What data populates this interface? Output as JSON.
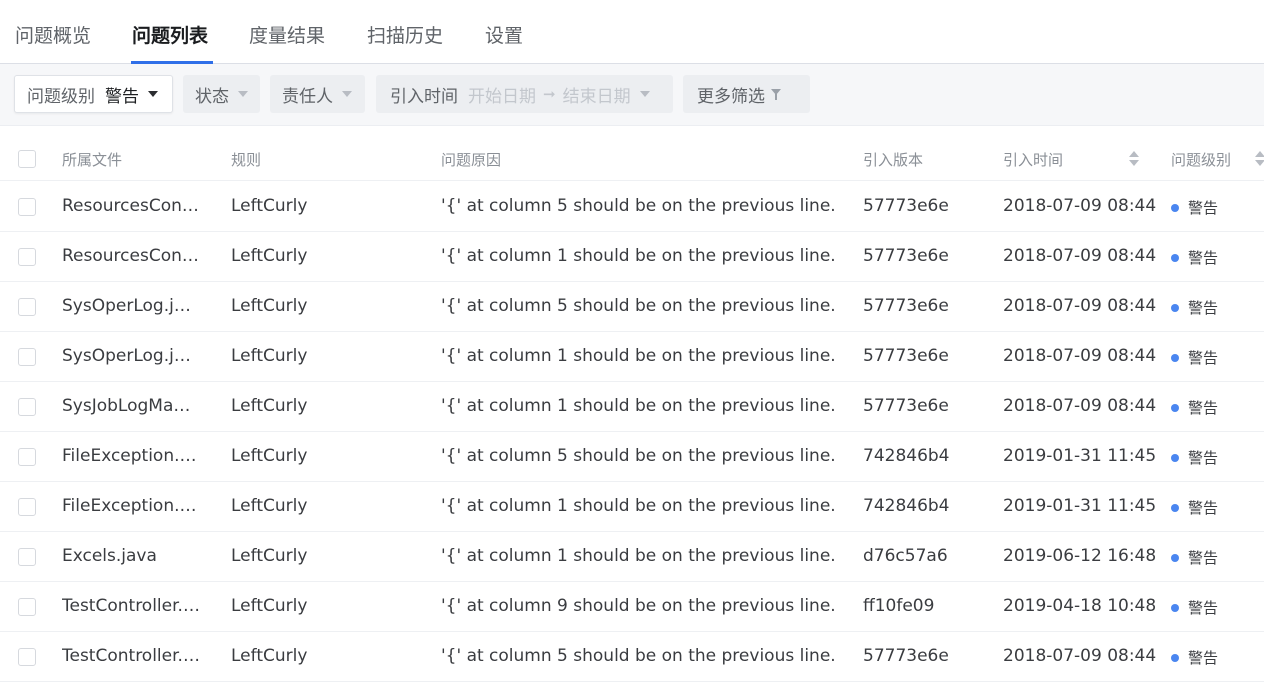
{
  "tabs": [
    {
      "label": "问题概览",
      "active": false
    },
    {
      "label": "问题列表",
      "active": true
    },
    {
      "label": "度量结果",
      "active": false
    },
    {
      "label": "扫描历史",
      "active": false
    },
    {
      "label": "设置",
      "active": false
    }
  ],
  "filters": {
    "level_label": "问题级别",
    "level_value": "警告",
    "status_label": "状态",
    "owner_label": "责任人",
    "intro_time_label": "引入时间",
    "start_date_placeholder": "开始日期",
    "date_separator": "➞",
    "end_date_placeholder": "结束日期",
    "more_filters_label": "更多筛选"
  },
  "table": {
    "columns": {
      "file": "所属文件",
      "rule": "规则",
      "reason": "问题原因",
      "version": "引入版本",
      "time": "引入时间",
      "level": "问题级别"
    },
    "level_dot_color": "#4a86f0",
    "rows": [
      {
        "file": "ResourcesConfig.java",
        "rule": "LeftCurly",
        "reason": "'{' at column 5 should be on the previous line.",
        "version": "57773e6e",
        "time": "2018-07-09 08:44",
        "level": "警告"
      },
      {
        "file": "ResourcesConfig.java",
        "rule": "LeftCurly",
        "reason": "'{' at column 1 should be on the previous line.",
        "version": "57773e6e",
        "time": "2018-07-09 08:44",
        "level": "警告"
      },
      {
        "file": "SysOperLog.java",
        "rule": "LeftCurly",
        "reason": "'{' at column 5 should be on the previous line.",
        "version": "57773e6e",
        "time": "2018-07-09 08:44",
        "level": "警告"
      },
      {
        "file": "SysOperLog.java",
        "rule": "LeftCurly",
        "reason": "'{' at column 1 should be on the previous line.",
        "version": "57773e6e",
        "time": "2018-07-09 08:44",
        "level": "警告"
      },
      {
        "file": "SysJobLogMapper.java",
        "rule": "LeftCurly",
        "reason": "'{' at column 1 should be on the previous line.",
        "version": "57773e6e",
        "time": "2018-07-09 08:44",
        "level": "警告"
      },
      {
        "file": "FileException.java",
        "rule": "LeftCurly",
        "reason": "'{' at column 5 should be on the previous line.",
        "version": "742846b4",
        "time": "2019-01-31 11:45",
        "level": "警告"
      },
      {
        "file": "FileException.java",
        "rule": "LeftCurly",
        "reason": "'{' at column 1 should be on the previous line.",
        "version": "742846b4",
        "time": "2019-01-31 11:45",
        "level": "警告"
      },
      {
        "file": "Excels.java",
        "rule": "LeftCurly",
        "reason": "'{' at column 1 should be on the previous line.",
        "version": "d76c57a6",
        "time": "2019-06-12 16:48",
        "level": "警告"
      },
      {
        "file": "TestController.java",
        "rule": "LeftCurly",
        "reason": "'{' at column 9 should be on the previous line.",
        "version": "ff10fe09",
        "time": "2019-04-18 10:48",
        "level": "警告"
      },
      {
        "file": "TestController.java",
        "rule": "LeftCurly",
        "reason": "'{' at column 5 should be on the previous line.",
        "version": "57773e6e",
        "time": "2018-07-09 08:44",
        "level": "警告"
      }
    ]
  }
}
